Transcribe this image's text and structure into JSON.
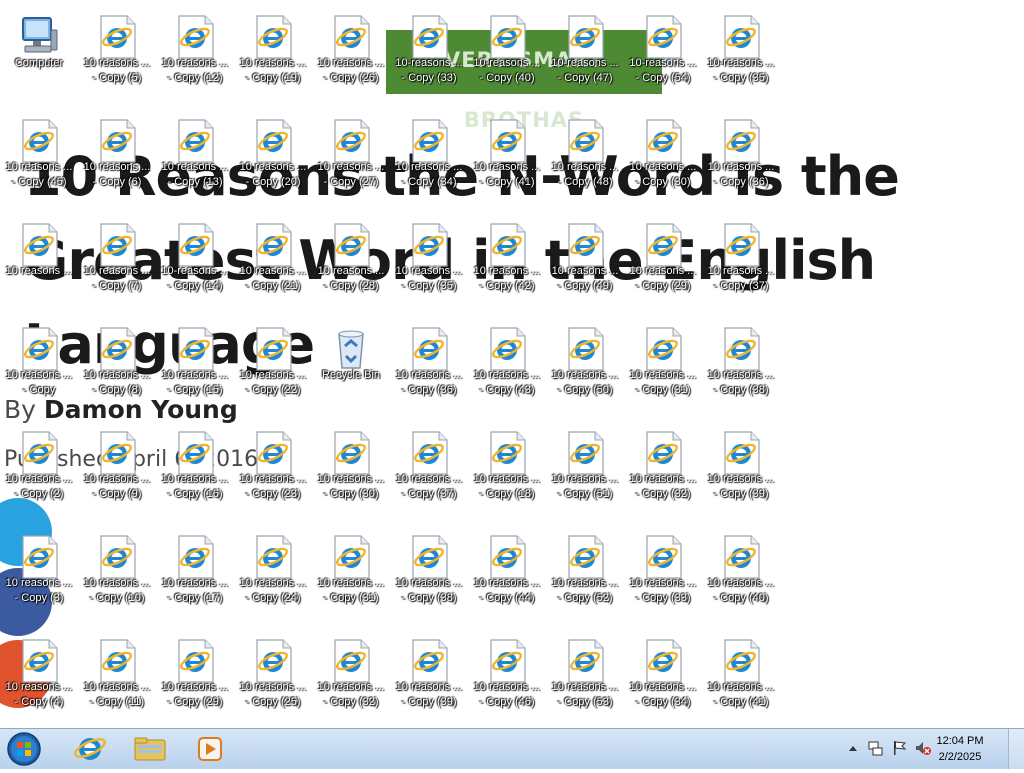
{
  "wallpaper": {
    "banner": "VERY SMART BROTHAS",
    "title": "10 Reasons the N-Word Is the Greatest Word in the English Language",
    "byline_prefix": "By",
    "author": "Damon Young",
    "published": "Published April 6, 2016"
  },
  "desktop_icons": [
    [
      {
        "name": "computer-icon",
        "l1": "Computer",
        "l2": ""
      },
      {
        "name": "ie-shortcut-icon",
        "l1": "10 reasons ...",
        "l2": "- Copy (5)"
      },
      {
        "name": "ie-shortcut-icon",
        "l1": "10 reasons ...",
        "l2": "- Copy (12)"
      },
      {
        "name": "ie-shortcut-icon",
        "l1": "10 reasons ...",
        "l2": "- Copy (19)"
      },
      {
        "name": "ie-shortcut-icon",
        "l1": "10 reasons ...",
        "l2": "- Copy (26)"
      },
      {
        "name": "ie-shortcut-icon",
        "l1": "10-reasons ...",
        "l2": "- Copy (33)"
      },
      {
        "name": "ie-shortcut-icon",
        "l1": "10-reasons ...",
        "l2": "- Copy (40)"
      },
      {
        "name": "ie-shortcut-icon",
        "l1": "10-reasons ...",
        "l2": "- Copy (47)"
      },
      {
        "name": "ie-shortcut-icon",
        "l1": "10-reasons ...",
        "l2": "- Copy (54)"
      },
      {
        "name": "ie-shortcut-icon",
        "l1": "10-reasons ...",
        "l2": "- Copy (35)"
      }
    ],
    [
      {
        "name": "ie-shortcut-icon",
        "l1": "10 reasons ...",
        "l2": "- Copy (45)"
      },
      {
        "name": "ie-shortcut-icon",
        "l1": "10 reasons ...",
        "l2": "- Copy (6)"
      },
      {
        "name": "ie-shortcut-icon",
        "l1": "10 reasons ...",
        "l2": "- Copy (13)"
      },
      {
        "name": "ie-shortcut-icon",
        "l1": "10 reasons ...",
        "l2": "- Copy (20)"
      },
      {
        "name": "ie-shortcut-icon",
        "l1": "10 reasons ...",
        "l2": "- Copy (27)"
      },
      {
        "name": "ie-shortcut-icon",
        "l1": "10 reasons ...",
        "l2": "- Copy (34)"
      },
      {
        "name": "ie-shortcut-icon",
        "l1": "10 reasons ...",
        "l2": "- Copy (41)"
      },
      {
        "name": "ie-shortcut-icon",
        "l1": "10 reasons ...",
        "l2": "- Copy (48)"
      },
      {
        "name": "ie-shortcut-icon",
        "l1": "10 reasons ...",
        "l2": "- Copy (30)"
      },
      {
        "name": "ie-shortcut-icon",
        "l1": "10 reasons ...",
        "l2": "- Copy (36)"
      }
    ],
    [
      {
        "name": "ie-shortcut-icon",
        "l1": "10 reasons ...",
        "l2": ""
      },
      {
        "name": "ie-shortcut-icon",
        "l1": "10 reasons ...",
        "l2": "- Copy (7)"
      },
      {
        "name": "ie-shortcut-icon",
        "l1": "10-reasons ...",
        "l2": "- Copy (14)"
      },
      {
        "name": "ie-shortcut-icon",
        "l1": "10 reasons ...",
        "l2": "- Copy (21)"
      },
      {
        "name": "ie-shortcut-icon",
        "l1": "10 reasons ...",
        "l2": "- Copy (28)"
      },
      {
        "name": "ie-shortcut-icon",
        "l1": "10 reasons ...",
        "l2": "- Copy (35)"
      },
      {
        "name": "ie-shortcut-icon",
        "l1": "10 reasons ...",
        "l2": "- Copy (42)"
      },
      {
        "name": "ie-shortcut-icon",
        "l1": "10 reasons ...",
        "l2": "- Copy (49)"
      },
      {
        "name": "ie-shortcut-icon",
        "l1": "10 reasons ...",
        "l2": "- Copy (29)"
      },
      {
        "name": "ie-shortcut-icon",
        "l1": "10 reasons ...",
        "l2": "- Copy (37)"
      }
    ],
    [
      {
        "name": "ie-shortcut-icon",
        "l1": "10 reasons ...",
        "l2": "- Copy"
      },
      {
        "name": "ie-shortcut-icon",
        "l1": "10 reasons ...",
        "l2": "- Copy (8)"
      },
      {
        "name": "ie-shortcut-icon",
        "l1": "10 reasons ...",
        "l2": "- Copy (15)"
      },
      {
        "name": "ie-shortcut-icon",
        "l1": "10 reasons ...",
        "l2": "- Copy (22)"
      },
      {
        "name": "recycle-bin-icon",
        "l1": "Recycle Bin",
        "l2": ""
      },
      {
        "name": "ie-shortcut-icon",
        "l1": "10 reasons ...",
        "l2": "- Copy (36)"
      },
      {
        "name": "ie-shortcut-icon",
        "l1": "10 reasons ...",
        "l2": "- Copy (43)"
      },
      {
        "name": "ie-shortcut-icon",
        "l1": "10 reasons ...",
        "l2": "- Copy (50)"
      },
      {
        "name": "ie-shortcut-icon",
        "l1": "10 reasons ...",
        "l2": "- Copy (31)"
      },
      {
        "name": "ie-shortcut-icon",
        "l1": "10 reasons ...",
        "l2": "- Copy (38)"
      }
    ],
    [
      {
        "name": "ie-shortcut-icon",
        "l1": "10 reasons ...",
        "l2": "- Copy (2)"
      },
      {
        "name": "ie-shortcut-icon",
        "l1": "10 reasons ...",
        "l2": "- Copy (9)"
      },
      {
        "name": "ie-shortcut-icon",
        "l1": "10 reasons ...",
        "l2": "- Copy (16)"
      },
      {
        "name": "ie-shortcut-icon",
        "l1": "10 reasons ...",
        "l2": "- Copy (23)"
      },
      {
        "name": "ie-shortcut-icon",
        "l1": "10 reasons ...",
        "l2": "- Copy (30)"
      },
      {
        "name": "ie-shortcut-icon",
        "l1": "10 reasons ...",
        "l2": "- Copy (37)"
      },
      {
        "name": "ie-shortcut-icon",
        "l1": "10 reasons ...",
        "l2": "- Copy (18)"
      },
      {
        "name": "ie-shortcut-icon",
        "l1": "10 reasons ...",
        "l2": "- Copy (51)"
      },
      {
        "name": "ie-shortcut-icon",
        "l1": "10 reasons ...",
        "l2": "- Copy (32)"
      },
      {
        "name": "ie-shortcut-icon",
        "l1": "10 reasons ...",
        "l2": "- Copy (39)"
      }
    ],
    [
      {
        "name": "ie-shortcut-icon",
        "l1": "10 reasons ...",
        "l2": "- Copy (3)"
      },
      {
        "name": "ie-shortcut-icon",
        "l1": "10 reasons ...",
        "l2": "- Copy (10)"
      },
      {
        "name": "ie-shortcut-icon",
        "l1": "10 reasons ...",
        "l2": "- Copy (17)"
      },
      {
        "name": "ie-shortcut-icon",
        "l1": "10 reasons ...",
        "l2": "- Copy (24)"
      },
      {
        "name": "ie-shortcut-icon",
        "l1": "10 reasons ...",
        "l2": "- Copy (31)"
      },
      {
        "name": "ie-shortcut-icon",
        "l1": "10 reasons ...",
        "l2": "- Copy (38)"
      },
      {
        "name": "ie-shortcut-icon",
        "l1": "10 reasons ...",
        "l2": "- Copy (44)"
      },
      {
        "name": "ie-shortcut-icon",
        "l1": "10 reasons ...",
        "l2": "- Copy (52)"
      },
      {
        "name": "ie-shortcut-icon",
        "l1": "10 reasons ...",
        "l2": "- Copy (33)"
      },
      {
        "name": "ie-shortcut-icon",
        "l1": "10 reasons ...",
        "l2": "- Copy (40)"
      }
    ],
    [
      {
        "name": "ie-shortcut-icon",
        "l1": "10 reasons ...",
        "l2": "- Copy (4)"
      },
      {
        "name": "ie-shortcut-icon",
        "l1": "10 reasons ...",
        "l2": "- Copy (11)"
      },
      {
        "name": "ie-shortcut-icon",
        "l1": "10 reasons ...",
        "l2": "- Copy (29)"
      },
      {
        "name": "ie-shortcut-icon",
        "l1": "10 reasons ...",
        "l2": "- Copy (25)"
      },
      {
        "name": "ie-shortcut-icon",
        "l1": "10 reasons ...",
        "l2": "- Copy (32)"
      },
      {
        "name": "ie-shortcut-icon",
        "l1": "10 reasons ...",
        "l2": "- Copy (39)"
      },
      {
        "name": "ie-shortcut-icon",
        "l1": "10 reasons ...",
        "l2": "- Copy (46)"
      },
      {
        "name": "ie-shortcut-icon",
        "l1": "10 reasons ...",
        "l2": "- Copy (53)"
      },
      {
        "name": "ie-shortcut-icon",
        "l1": "10 reasons ...",
        "l2": "- Copy (34)"
      },
      {
        "name": "ie-shortcut-icon",
        "l1": "10 reasons ...",
        "l2": "- Copy (41)"
      }
    ]
  ],
  "taskbar": {
    "time": "12:04 PM",
    "date": "2/2/2025",
    "items": [
      "start-button-icon",
      "internet-explorer-icon",
      "file-explorer-icon",
      "media-player-icon"
    ],
    "tray": [
      "show-hidden-icons-icon",
      "network-icon",
      "action-center-flag-icon",
      "volume-muted-icon"
    ]
  },
  "colors": {
    "taskbar": "#c3d8ef",
    "banner": "#4d8a33",
    "ie_blue": "#1e88d8",
    "ie_ring": "#f1b52a"
  }
}
